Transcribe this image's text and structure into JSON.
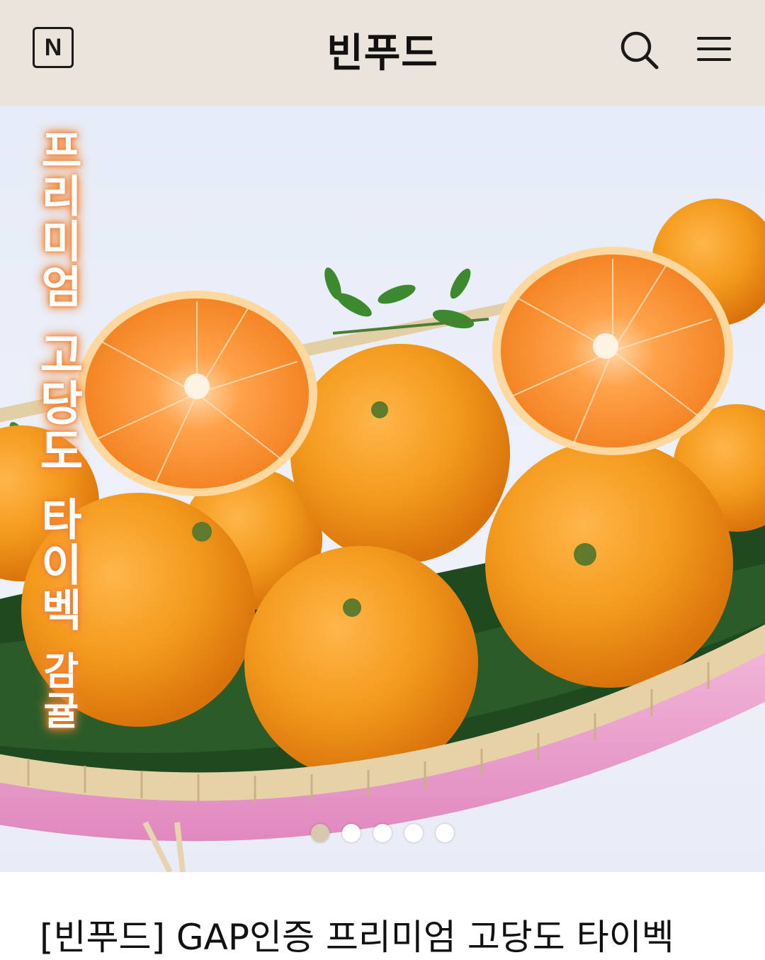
{
  "header": {
    "logo_letter": "N",
    "title": "빈푸드",
    "background_color": "#ebe4dc",
    "icons": [
      "naver-n-icon",
      "search-icon",
      "menu-icon"
    ]
  },
  "banner": {
    "vertical_text": [
      "프리미엄",
      "고당도",
      "타이벡",
      "감귤"
    ],
    "text_glow_color": "#f07a2a",
    "slides_total": 5,
    "active_slide": 1
  },
  "product": {
    "title": "[빈푸드] GAP인증 프리미엄 고당도 타이벡"
  }
}
